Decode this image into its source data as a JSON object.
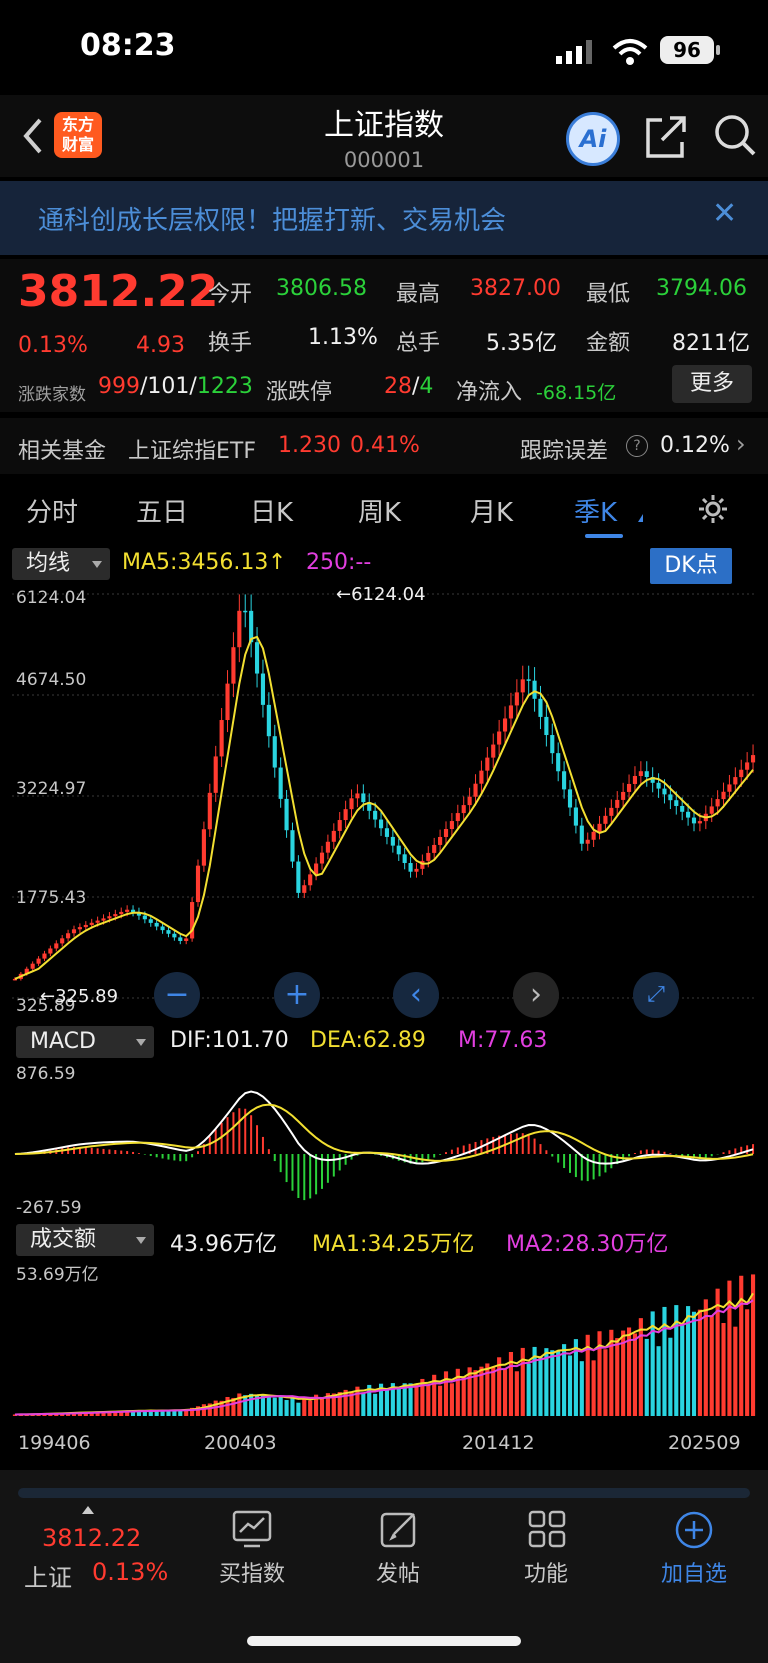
{
  "status_bar": {
    "time": "08:23",
    "battery": "96"
  },
  "header": {
    "logo_line1": "东方",
    "logo_line2": "财富",
    "title": "上证指数",
    "code": "000001",
    "ai_label": "Ai"
  },
  "banner": {
    "text": "通科创成长层权限！把握打新、交易机会"
  },
  "quote": {
    "price": "3812.22",
    "change_pct": "0.13%",
    "change": "4.93",
    "open_label": "今开",
    "open": "3806.58",
    "high_label": "最高",
    "high": "3827.00",
    "low_label": "最低",
    "low": "3794.06",
    "turnover_label": "换手",
    "turnover": "1.13%",
    "volume_label": "总手",
    "volume": "5.35亿",
    "amount_label": "金额",
    "amount": "8211亿",
    "breadth_label": "涨跌家数",
    "breadth_up": "999",
    "breadth_flat": "101",
    "breadth_down": "1223",
    "limit_label": "涨跌停",
    "limit_up": "28",
    "limit_down": "4",
    "inflow_label": "净流入",
    "inflow": "-68.15亿",
    "more_label": "更多"
  },
  "fund": {
    "label": "相关基金",
    "name": "上证综指ETF",
    "price": "1.230",
    "pct": "0.41%",
    "track_label": "跟踪误差",
    "track_value": "0.12%"
  },
  "tabs": [
    "分时",
    "五日",
    "日K",
    "周K",
    "月K",
    "季K"
  ],
  "main_chart": {
    "selector": "均线",
    "ma5": "MA5:3456.13",
    "ma250": "250:--",
    "dk_label": "DK点",
    "y_ticks": [
      "6124.04",
      "4674.50",
      "3224.97",
      "1775.43",
      "325.89"
    ],
    "high_marker": "6124.04",
    "low_marker": "325.89"
  },
  "macd": {
    "selector": "MACD",
    "dif": "DIF:101.70",
    "dea": "DEA:62.89",
    "m": "M:77.63",
    "top": "876.59",
    "bottom": "-267.59"
  },
  "volume": {
    "selector": "成交额",
    "value": "43.96万亿",
    "ma1": "MA1:34.25万亿",
    "ma2": "MA2:28.30万亿",
    "top": "53.69万亿"
  },
  "x_ticks": [
    "199406",
    "200403",
    "201412",
    "202509"
  ],
  "bottom_nav": {
    "index_price": "3812.22",
    "index_name": "上证",
    "index_pct": "0.13%",
    "buy": "买指数",
    "post": "发帖",
    "func": "功能",
    "watch": "加自选"
  },
  "colors": {
    "up": "#ff3b30",
    "down": "#2bd13a",
    "candle_down": "#2ad4e0",
    "ma_yellow": "#f2df31",
    "ma_white": "#ffffff",
    "ma_magenta": "#e23fe0",
    "accent": "#3f86e6"
  },
  "chart_data": {
    "type": "candlestick",
    "title": "上证指数 季K",
    "ylim": [
      325.89,
      6124.04
    ],
    "x_ticks": [
      "199406",
      "200403",
      "201412",
      "202509"
    ],
    "trend_points": [
      {
        "x": "199406",
        "y": 600
      },
      {
        "x": "199812",
        "y": 1300
      },
      {
        "x": "200403",
        "y": 1600
      },
      {
        "x": "200512",
        "y": 1100
      },
      {
        "x": "200709",
        "y": 6124.04
      },
      {
        "x": "200812",
        "y": 1800
      },
      {
        "x": "200912",
        "y": 3300
      },
      {
        "x": "201212",
        "y": 2100
      },
      {
        "x": "201412",
        "y": 3200
      },
      {
        "x": "201506",
        "y": 5000
      },
      {
        "x": "201812",
        "y": 2500
      },
      {
        "x": "202112",
        "y": 3600
      },
      {
        "x": "202409",
        "y": 2800
      },
      {
        "x": "202509",
        "y": 3812.22
      }
    ]
  }
}
